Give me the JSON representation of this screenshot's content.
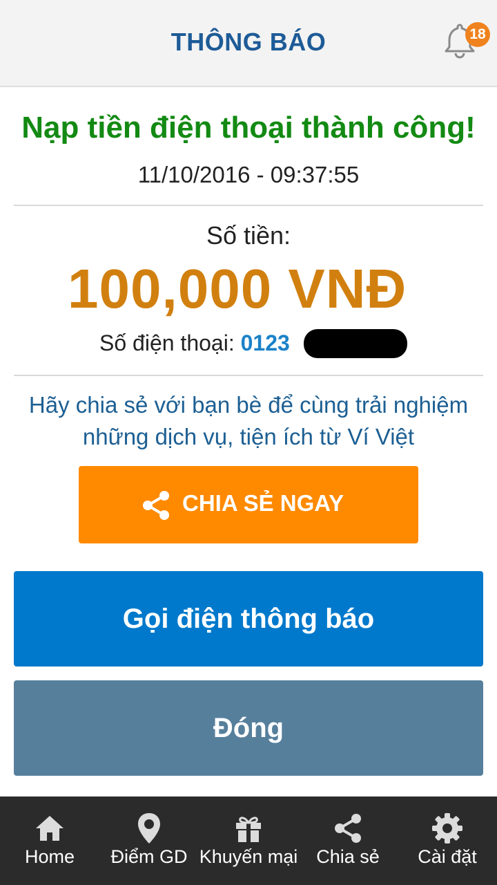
{
  "header": {
    "title": "THÔNG BÁO",
    "notification_count": "18",
    "bell_icon": "bell-icon"
  },
  "result": {
    "title": "Nạp tiền điện thoại thành công!",
    "datetime": "11/10/2016 - 09:37:55",
    "amount_label": "Số tiền:",
    "amount": "100,000 VNĐ",
    "phone_label": "Số điện thoại: ",
    "phone_value": "0123"
  },
  "share": {
    "message": "Hãy chia sẻ với bạn bè để cùng trải nghiệm những dịch vụ, tiện ích từ Ví Việt",
    "button_label": "CHIA SẺ NGAY"
  },
  "actions": {
    "call_label": "Gọi điện thông báo",
    "close_label": "Đóng"
  },
  "nav": {
    "items": [
      {
        "label": "Home",
        "icon": "home-icon"
      },
      {
        "label": "Điểm GD",
        "icon": "location-pin-icon"
      },
      {
        "label": "Khuyến mại",
        "icon": "gift-icon"
      },
      {
        "label": "Chia sẻ",
        "icon": "share-icon"
      },
      {
        "label": "Cài đặt",
        "icon": "gear-icon"
      }
    ]
  },
  "colors": {
    "header_title": "#1d5b97",
    "success": "#138a13",
    "amount": "#d1800f",
    "share_button": "#ff8a00",
    "call_button": "#0079cc",
    "close_button": "#567f9c",
    "navbar": "#2b2b2b",
    "badge": "#f0821e"
  }
}
